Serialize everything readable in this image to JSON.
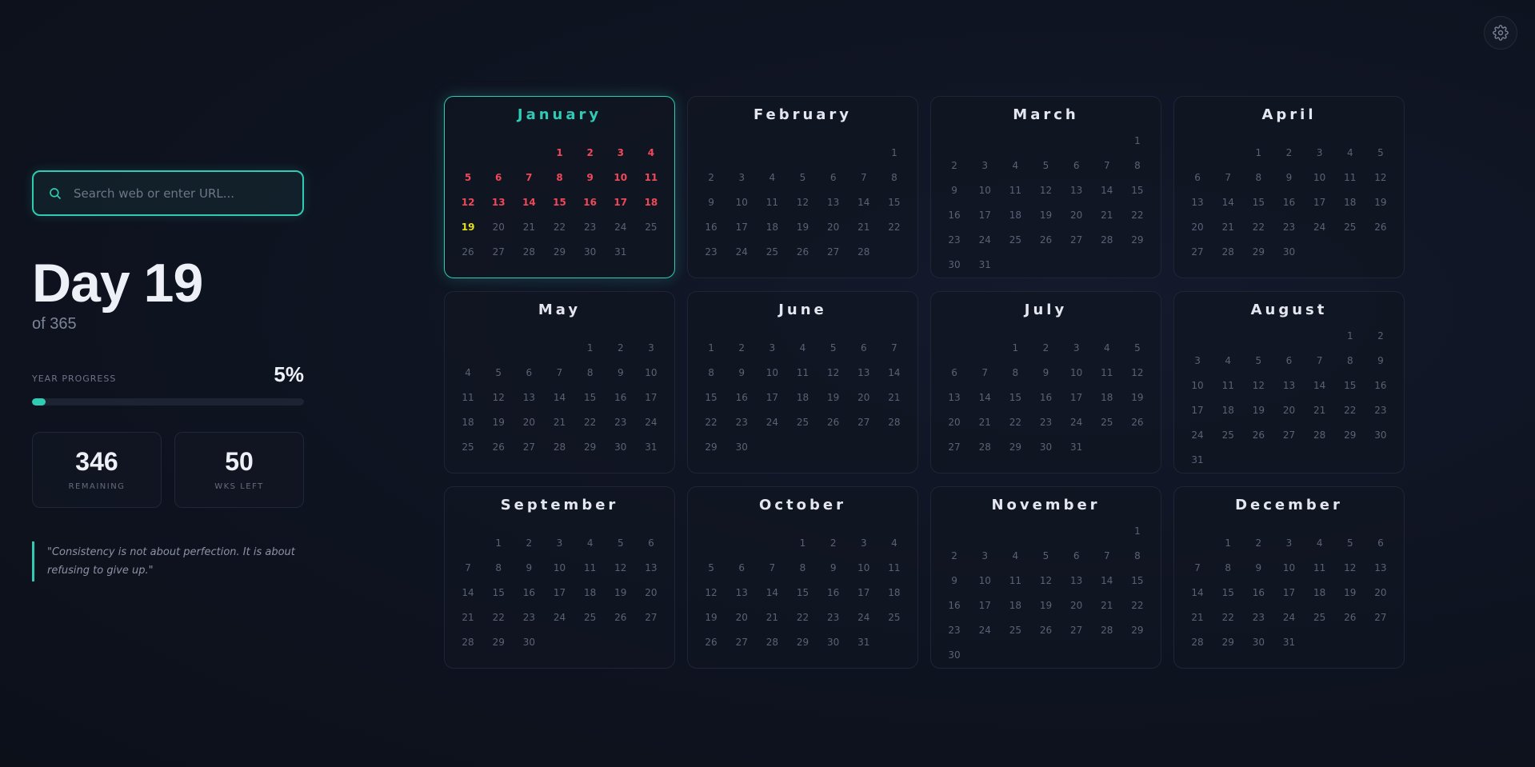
{
  "settings": {
    "icon": "gear-icon"
  },
  "search": {
    "placeholder": "Search web or enter URL...",
    "value": "",
    "icon": "search-icon"
  },
  "day": {
    "title": "Day 19",
    "of": "of 365"
  },
  "progress": {
    "label": "YEAR PROGRESS",
    "percent_text": "5%",
    "percent": 5
  },
  "stats": [
    {
      "value": "346",
      "label": "REMAINING"
    },
    {
      "value": "50",
      "label": "WKS LEFT"
    }
  ],
  "quote": "\"Consistency is not about perfection. It is about refusing to give up.\"",
  "calendar": {
    "year_start_weekday": 3,
    "current_month": 0,
    "today": 19,
    "months": [
      {
        "name": "January",
        "days": 31
      },
      {
        "name": "February",
        "days": 28
      },
      {
        "name": "March",
        "days": 31
      },
      {
        "name": "April",
        "days": 30
      },
      {
        "name": "May",
        "days": 31
      },
      {
        "name": "June",
        "days": 30
      },
      {
        "name": "July",
        "days": 31
      },
      {
        "name": "August",
        "days": 31
      },
      {
        "name": "September",
        "days": 30
      },
      {
        "name": "October",
        "days": 31
      },
      {
        "name": "November",
        "days": 30
      },
      {
        "name": "December",
        "days": 31
      }
    ]
  },
  "colors": {
    "accent": "#2fcbb3",
    "past": "#ef4858",
    "today": "#e5e01e"
  }
}
